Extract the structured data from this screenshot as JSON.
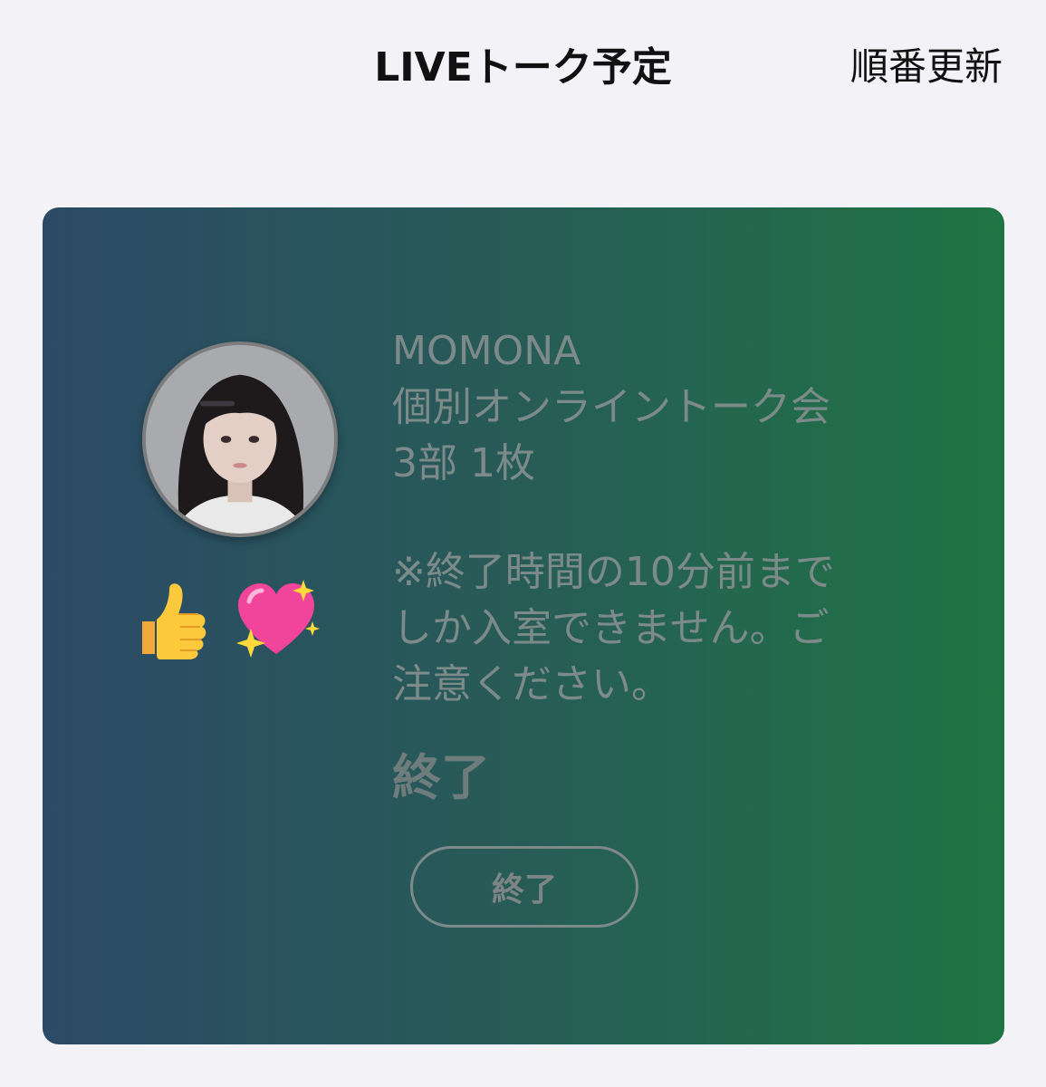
{
  "header": {
    "title": "LIVEトーク予定",
    "reorder_label": "順番更新"
  },
  "card": {
    "name": "MOMONA",
    "event": "個別オンライントーク会",
    "ticket": "3部 1枚",
    "notice_lines": [
      "※終了時間の10分前まで",
      "しか入室できません。ご",
      "注意ください。"
    ],
    "status": "終了",
    "button_label": "終了",
    "avatar_icon": "profile-photo",
    "reactions": [
      "thumbs-up-icon",
      "sparkling-heart-icon"
    ],
    "colors": {
      "gradient_start": "#2b4a66",
      "gradient_end": "#1f7444",
      "muted_text": "#7d8a8a"
    }
  }
}
